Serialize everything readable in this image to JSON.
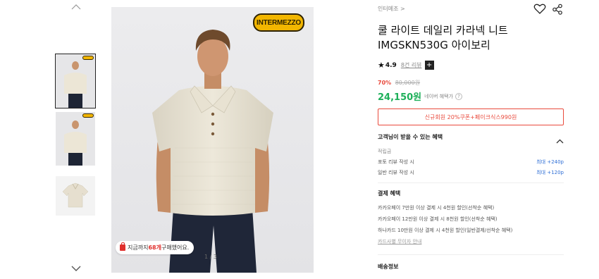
{
  "gallery": {
    "thumbnails": [
      {
        "label": "model-front"
      },
      {
        "label": "model-front-2"
      },
      {
        "label": "flat-lay"
      }
    ],
    "brand_logo_text": "INTERMEZZO",
    "purchase_notice": {
      "prefix": "지금까지 ",
      "count": "68개",
      "suffix": " 구매했어요."
    },
    "page_counter": "1 / 3"
  },
  "product": {
    "breadcrumb": "인터메조 >",
    "title": "쿨 라이트 데일리 카라넥 니트 IMGSKN530G 아이보리",
    "rating": "4.9",
    "review_count": "8건 리뷰",
    "discount_rate": "70%",
    "original_price": "80,000원",
    "price": "24,150원",
    "price_label": "네이버 혜택가",
    "coupon_button": "신규회원 20%쿠폰+페이크식스990원"
  },
  "benefits": {
    "title": "고객님이 받을 수 있는 혜택",
    "points_label": "적립금",
    "rows": [
      {
        "label": "포토 리뷰 작성 시",
        "value": "최대 +240p"
      },
      {
        "label": "일반 리뷰 작성 시",
        "value": "최대 +120p"
      }
    ]
  },
  "payment": {
    "title": "결제 혜택",
    "rows": [
      "카카오페이 7만원 이상 결제 시 4천원 할인(선착순 혜택)",
      "카카오페이 12만원 이상 결제 시 8천원 할인(선착순 혜택)",
      "하나카드 10만원 이상 결제 시 4천원 할인(일반결제/선착순 혜택)"
    ],
    "card_link": "카드사별 무이자 안내"
  },
  "shipping": {
    "title": "배송정보"
  },
  "colors": {
    "accent_red": "#e94a3c",
    "price_green": "#1eb05a",
    "link_blue": "#2f6fd6"
  }
}
